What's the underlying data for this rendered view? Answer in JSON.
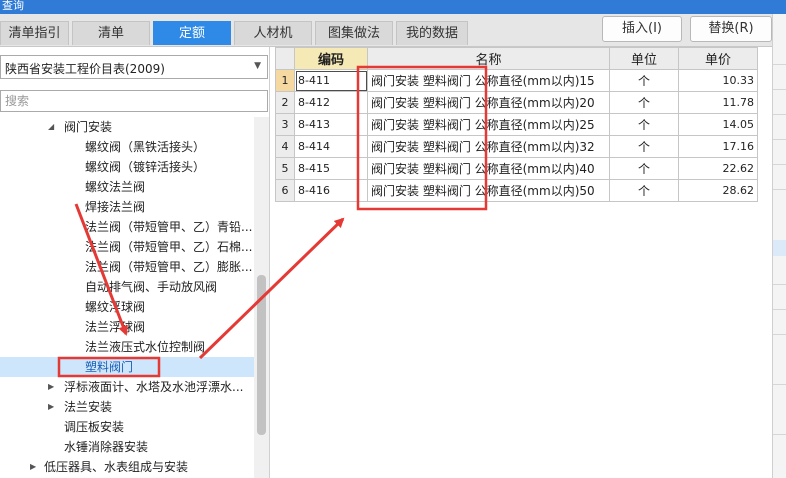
{
  "window": {
    "title": "查询"
  },
  "tabs": [
    {
      "label": "清单指引",
      "active": false
    },
    {
      "label": "清单",
      "active": false
    },
    {
      "label": "定额",
      "active": true
    },
    {
      "label": "人材机",
      "active": false
    },
    {
      "label": "图集做法",
      "active": false
    },
    {
      "label": "我的数据",
      "active": false
    }
  ],
  "toolbar": {
    "insert_label": "插入(I)",
    "replace_label": "替换(R)"
  },
  "library_select": {
    "value": "陕西省安装工程价目表(2009)"
  },
  "search": {
    "placeholder": "搜索"
  },
  "tree": [
    {
      "label": "阀门安装",
      "expanded": true
    },
    {
      "label": "螺纹阀（黑铁活接头）"
    },
    {
      "label": "螺纹阀（镀锌活接头）"
    },
    {
      "label": "螺纹法兰阀"
    },
    {
      "label": "焊接法兰阀"
    },
    {
      "label": "法兰阀（带短管甲、乙）青铅..."
    },
    {
      "label": "法兰阀（带短管甲、乙）石棉..."
    },
    {
      "label": "法兰阀（带短管甲、乙）膨胀..."
    },
    {
      "label": "自动排气阀、手动放风阀"
    },
    {
      "label": "螺纹浮球阀"
    },
    {
      "label": "法兰浮球阀"
    },
    {
      "label": "法兰液压式水位控制阀"
    },
    {
      "label": "塑料阀门",
      "selected": true
    },
    {
      "label": "浮标液面计、水塔及水池浮漂水...",
      "expanded": false
    },
    {
      "label": "法兰安装",
      "expanded": false
    },
    {
      "label": "调压板安装"
    },
    {
      "label": "水锤消除器安装"
    },
    {
      "label": "低压器具、水表组成与安装",
      "expanded": false
    }
  ],
  "table": {
    "columns": [
      "编码",
      "名称",
      "单位",
      "单价"
    ],
    "rows": [
      {
        "num": "1",
        "code": "8-411",
        "name": "阀门安装 塑料阀门 公称直径(mm以内)15",
        "unit": "个",
        "price": "10.33"
      },
      {
        "num": "2",
        "code": "8-412",
        "name": "阀门安装 塑料阀门 公称直径(mm以内)20",
        "unit": "个",
        "price": "11.78"
      },
      {
        "num": "3",
        "code": "8-413",
        "name": "阀门安装 塑料阀门 公称直径(mm以内)25",
        "unit": "个",
        "price": "14.05"
      },
      {
        "num": "4",
        "code": "8-414",
        "name": "阀门安装 塑料阀门 公称直径(mm以内)32",
        "unit": "个",
        "price": "17.16"
      },
      {
        "num": "5",
        "code": "8-415",
        "name": "阀门安装 塑料阀门 公称直径(mm以内)40",
        "unit": "个",
        "price": "22.62"
      },
      {
        "num": "6",
        "code": "8-416",
        "name": "阀门安装 塑料阀门 公称直径(mm以内)50",
        "unit": "个",
        "price": "28.62"
      }
    ]
  },
  "colors": {
    "accent": "#2e8ae6",
    "annotation": "#e53935",
    "selection": "#cde6fb"
  }
}
